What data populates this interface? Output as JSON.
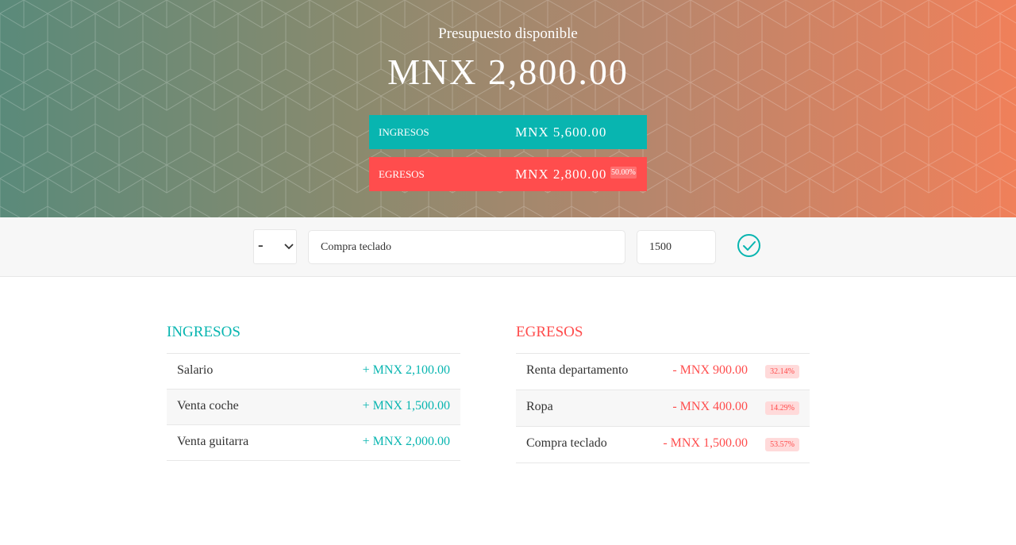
{
  "header": {
    "title": "Presupuesto disponible",
    "budget": "MNX 2,800.00",
    "income": {
      "label": "Ingresos",
      "value": "MNX 5,600.00"
    },
    "expense": {
      "label": "Egresos",
      "value": "MNX 2,800.00",
      "percentage": "50.00%"
    }
  },
  "add_form": {
    "type_selected": "-",
    "description_value": "Compra teclado",
    "amount_value": "1500",
    "submit_icon": "check-circle-icon"
  },
  "income_list": {
    "title": "Ingresos",
    "items": [
      {
        "description": "Salario",
        "value": "+ MNX 2,100.00"
      },
      {
        "description": "Venta coche",
        "value": "+ MNX 1,500.00"
      },
      {
        "description": "Venta guitarra",
        "value": "+ MNX 2,000.00"
      }
    ]
  },
  "expense_list": {
    "title": "Egresos",
    "items": [
      {
        "description": "Renta departamento",
        "value": "- MNX 900.00",
        "percentage": "32.14%"
      },
      {
        "description": "Ropa",
        "value": "- MNX 400.00",
        "percentage": "14.29%"
      },
      {
        "description": "Compra teclado",
        "value": "- MNX 1,500.00",
        "percentage": "53.57%"
      }
    ]
  },
  "colors": {
    "income": "#08b5b0",
    "expense": "#ff4d4d",
    "header_gradient_start": "#5a8a7a",
    "header_gradient_end": "#f0805a"
  }
}
